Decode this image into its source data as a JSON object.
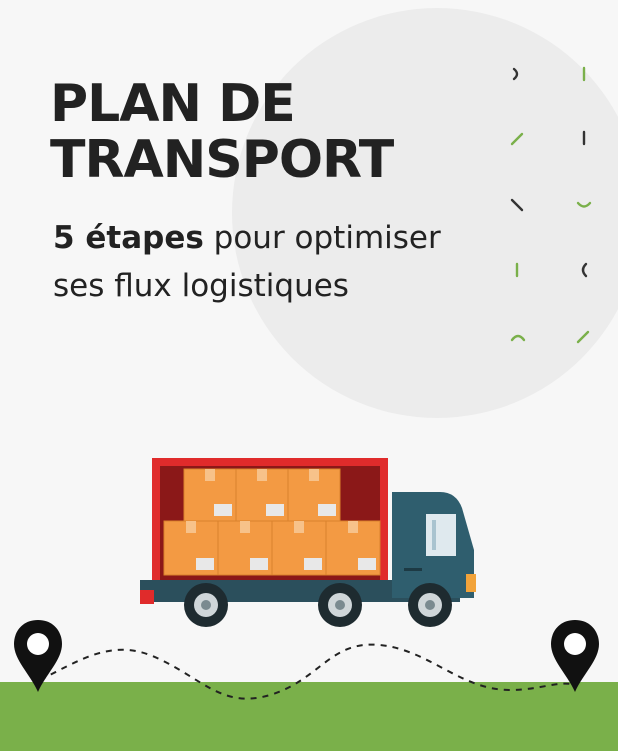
{
  "title": {
    "line1": "PLAN DE",
    "line2": "TRANSPORT"
  },
  "subtitle": {
    "bold": "5 étapes",
    "rest_line1": " pour optimiser",
    "line2": "ses flux logistiques"
  },
  "colors": {
    "text": "#222222",
    "accent_green": "#7ab04a",
    "truck_body_red": "#e02b2b",
    "truck_cab": "#2f5e6e",
    "box_orange": "#f39a43"
  },
  "icons": [
    "location-pin-icon",
    "truck-icon",
    "cardboard-box-icon"
  ]
}
